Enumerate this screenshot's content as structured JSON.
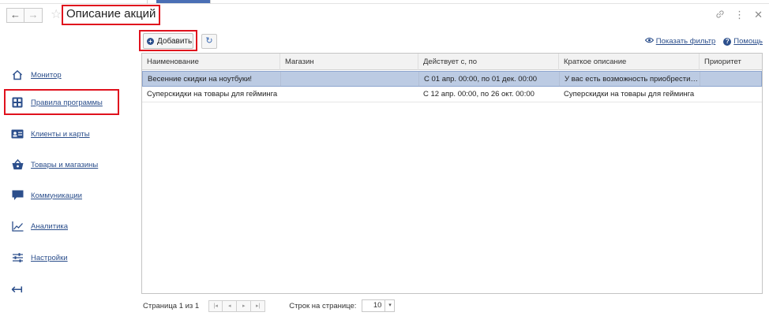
{
  "window": {
    "title": "Описание акций",
    "back_glyph": "←",
    "forward_glyph": "→",
    "star_glyph": "☆",
    "link_glyph": "🔗",
    "more_glyph": "⋮",
    "close_glyph": "✕"
  },
  "toolbar": {
    "add_label": "Добавить",
    "add_icon": "+",
    "refresh_glyph": "↻",
    "show_filter_label": "Показать фильтр",
    "help_label": "Помощь",
    "help_icon": "?"
  },
  "sidebar": {
    "items": [
      {
        "label": "Монитор",
        "icon": "home-icon"
      },
      {
        "label": "Правила программы",
        "icon": "grid-apps-icon"
      },
      {
        "label": "Клиенты и карты",
        "icon": "id-card-icon"
      },
      {
        "label": "Товары и магазины",
        "icon": "basket-icon"
      },
      {
        "label": "Коммуникации",
        "icon": "chat-icon"
      },
      {
        "label": "Аналитика",
        "icon": "chart-line-icon"
      },
      {
        "label": "Настройки",
        "icon": "sliders-icon"
      }
    ],
    "collapse_glyph": "↤"
  },
  "table": {
    "columns": [
      "Наименование",
      "Магазин",
      "Действует с, по",
      "Краткое описание",
      "Приоритет"
    ],
    "rows": [
      {
        "name": "Весенние скидки на ноутбуки!",
        "store": "",
        "period": "С 01 апр. 00:00, по 01 дек. 00:00",
        "description": "У вас есть возможность приобрести…",
        "priority": "",
        "selected": true
      },
      {
        "name": "Суперскидки на товары для гейминга",
        "store": "",
        "period": "С 12 апр. 00:00, по 26 окт. 00:00",
        "description": "Суперскидки на товары для гейминга",
        "priority": "",
        "selected": false
      }
    ]
  },
  "pager": {
    "page_text": "Страница 1 из 1",
    "first_glyph": "|◂",
    "prev_glyph": "◂",
    "next_glyph": "▸",
    "last_glyph": "▸|",
    "rows_label": "Строк на странице:",
    "rows_value": "10",
    "dropdown_glyph": "▾"
  },
  "colors": {
    "accent": "#2c4f8c",
    "highlight_frame": "#e0111d",
    "selected_row": "#bccbe3"
  }
}
